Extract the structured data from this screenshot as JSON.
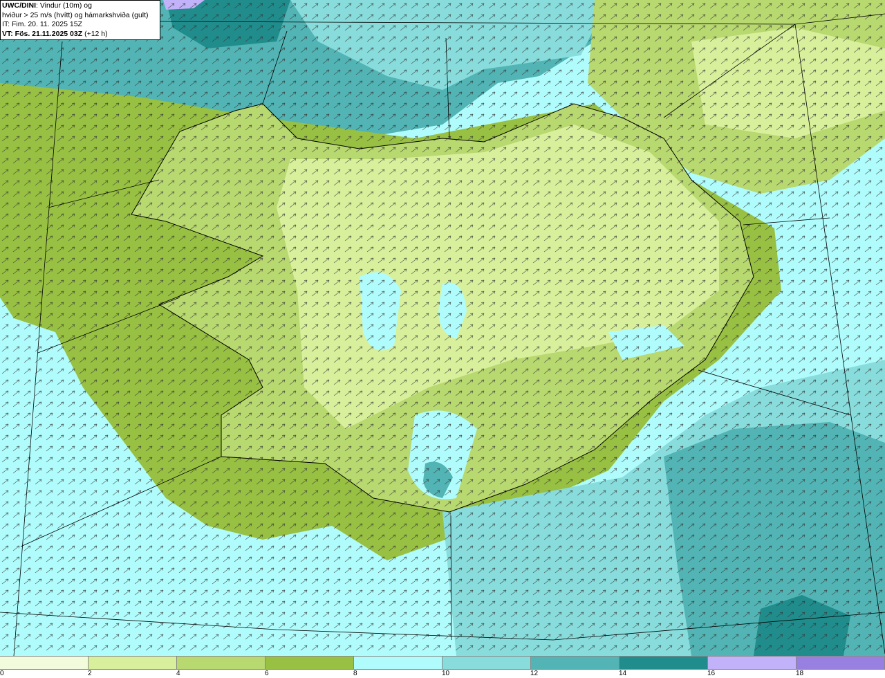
{
  "title": {
    "model": "UWC/DINI",
    "line1_rest": ": Vindur (10m) og",
    "line2": "hviður > 25 m/s (hvítt) og hámarkshviða (gult)",
    "it": "IT: Fim. 20. 11. 2025 15Z",
    "vt_bold": "VT: Fös. 21.11.2025 03Z",
    "vt_lead": " (+12 h)"
  },
  "legend": {
    "ticks": [
      "0",
      "2",
      "4",
      "6",
      "8",
      "10",
      "12",
      "14",
      "16",
      "18"
    ],
    "colors": [
      "#f2fcdc",
      "#d8f09c",
      "#b8d870",
      "#98c042",
      "#b0fcfc",
      "#88dcdc",
      "#52b4b4",
      "#208c8c",
      "#c2b2fa",
      "#9880e0"
    ]
  },
  "map": {
    "ocean_color": "#b0fcfc",
    "arrow_color": "#333333",
    "coast_color": "#000000"
  }
}
